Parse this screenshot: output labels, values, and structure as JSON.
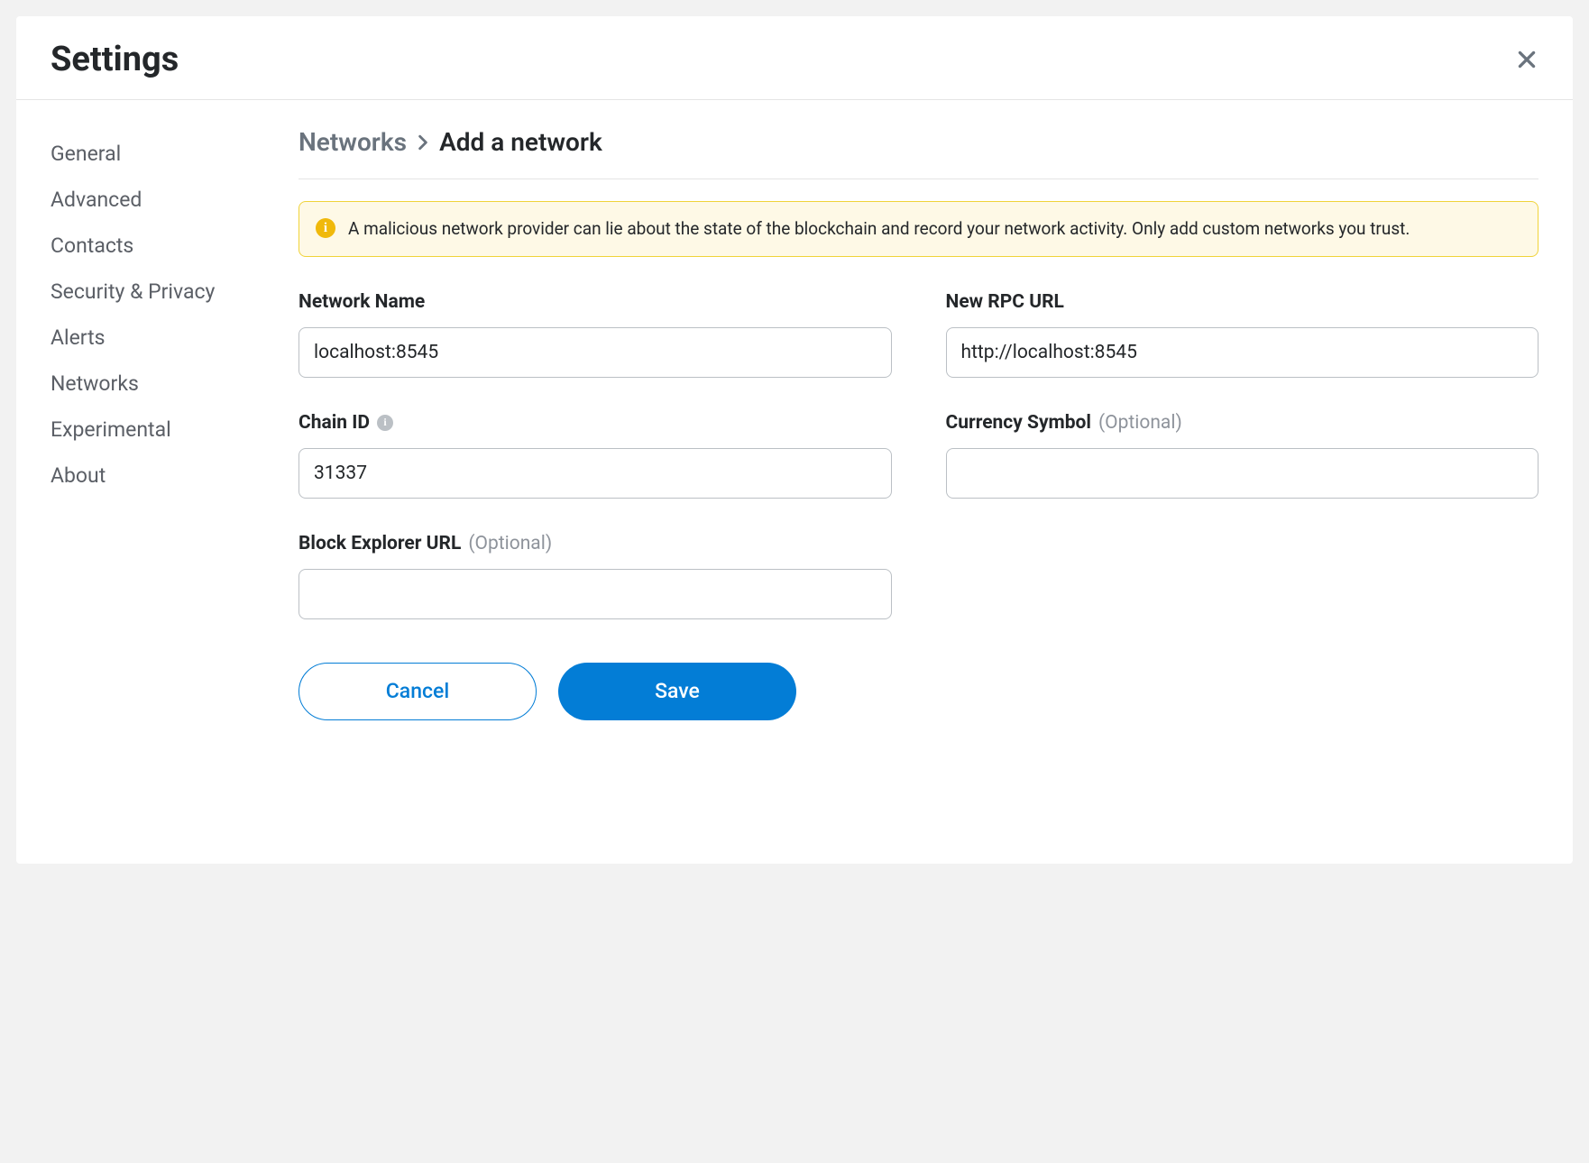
{
  "header": {
    "title": "Settings"
  },
  "sidebar": {
    "items": [
      {
        "label": "General"
      },
      {
        "label": "Advanced"
      },
      {
        "label": "Contacts"
      },
      {
        "label": "Security & Privacy"
      },
      {
        "label": "Alerts"
      },
      {
        "label": "Networks"
      },
      {
        "label": "Experimental"
      },
      {
        "label": "About"
      }
    ]
  },
  "breadcrumb": {
    "root": "Networks",
    "current": "Add a network"
  },
  "warning": {
    "text": "A malicious network provider can lie about the state of the blockchain and record your network activity. Only add custom networks you trust."
  },
  "form": {
    "network_name": {
      "label": "Network Name",
      "value": "localhost:8545"
    },
    "rpc_url": {
      "label": "New RPC URL",
      "value": "http://localhost:8545"
    },
    "chain_id": {
      "label": "Chain ID",
      "value": "31337"
    },
    "currency_symbol": {
      "label": "Currency Symbol",
      "optional": "(Optional)",
      "value": ""
    },
    "block_explorer": {
      "label": "Block Explorer URL",
      "optional": "(Optional)",
      "value": ""
    }
  },
  "buttons": {
    "cancel": "Cancel",
    "save": "Save"
  },
  "icons": {
    "info_glyph": "i",
    "warning_glyph": "i"
  }
}
